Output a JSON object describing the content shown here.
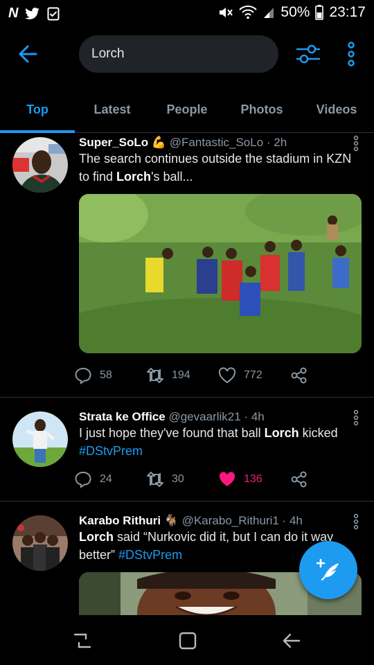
{
  "status_bar": {
    "left_icons": [
      "netflix-icon",
      "twitter-icon",
      "checkbox-icon"
    ],
    "netflix_glyph": "N",
    "battery": "50%",
    "time": "23:17"
  },
  "search": {
    "query": "Lorch"
  },
  "tabs": [
    {
      "label": "Top",
      "active": true
    },
    {
      "label": "Latest",
      "active": false
    },
    {
      "label": "People",
      "active": false
    },
    {
      "label": "Photos",
      "active": false
    },
    {
      "label": "Videos",
      "active": false
    }
  ],
  "tweets": [
    {
      "name": "Super_SoLo",
      "emoji": "💪",
      "handle": "@Fantastic_SoLo",
      "dot": "·",
      "time": "2h",
      "text_part1": "The search continues outside the stadium in KZN to find ",
      "text_bold": "Lorch",
      "text_part2": "'s ball...",
      "replies": "58",
      "retweets": "194",
      "likes": "772"
    },
    {
      "name": "Strata ke Office",
      "handle": "@gevaarlik21",
      "dot": "·",
      "time": "4h",
      "text_part1": "I just hope they've found that ball ",
      "text_bold": "Lorch",
      "text_part2": " kicked",
      "hashtag": "#DStvPrem",
      "replies": "24",
      "retweets": "30",
      "likes": "136"
    },
    {
      "name": "Karabo Rithuri",
      "emoji": "🐐",
      "handle": "@Karabo_Rithuri1",
      "dot": "·",
      "time": "4h",
      "text_bold": "Lorch",
      "text_part1": " said “Nurkovic did it, but I can do it way better”",
      "hashtag": "#DStvPrem"
    }
  ],
  "colors": {
    "accent": "#1d9bf0",
    "like": "#f91880",
    "muted": "#8b98a5",
    "divider": "#2f3336"
  }
}
